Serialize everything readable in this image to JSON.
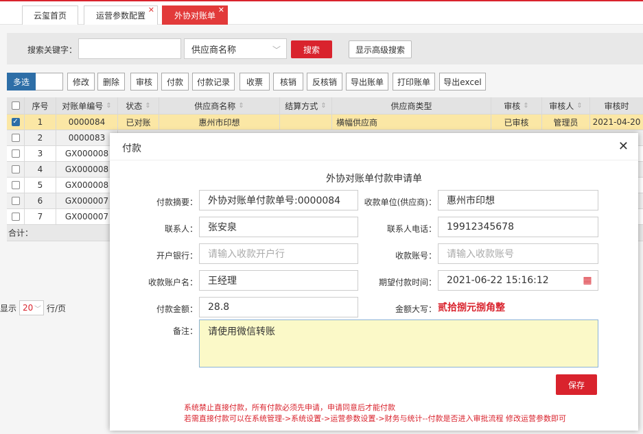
{
  "tabs": [
    {
      "label": "云玺首页",
      "closable": false
    },
    {
      "label": "运营参数配置",
      "closable": true
    },
    {
      "label": "外协对账单",
      "closable": true,
      "active": true
    }
  ],
  "search": {
    "keyword_label": "搜索关键字：",
    "keyword_value": "",
    "field_select": "供应商名称",
    "search_button": "搜索",
    "advanced_button": "显示高级搜索"
  },
  "toolbar": {
    "multi": "多选",
    "buttons": [
      "修改",
      "删除",
      "审核",
      "付款",
      "付款记录",
      "收票",
      "核销",
      "反核销",
      "导出账单",
      "打印账单",
      "导出excel"
    ]
  },
  "table": {
    "headers": [
      "序号",
      "对账单编号",
      "状态",
      "供应商名称",
      "结算方式",
      "供应商类型",
      "审核",
      "审核人",
      "审核时"
    ],
    "rows": [
      {
        "no": "1",
        "code": "0000084",
        "status": "已对账",
        "supplier": "惠州市印想",
        "settle": "",
        "type": "横幅供应商",
        "audit": "已审核",
        "auditor": "管理员",
        "time": "2021-04-20",
        "checked": true
      },
      {
        "no": "2",
        "code": "0000083",
        "checked": false
      },
      {
        "no": "3",
        "code": "GX000008",
        "checked": false
      },
      {
        "no": "4",
        "code": "GX000008",
        "checked": false
      },
      {
        "no": "5",
        "code": "GX000008",
        "checked": false
      },
      {
        "no": "6",
        "code": "GX000007",
        "checked": false
      },
      {
        "no": "7",
        "code": "GX000007",
        "checked": false
      }
    ],
    "total_label": "合计："
  },
  "pager": {
    "prefix": "显示",
    "size": "20",
    "suffix": "行/页"
  },
  "modal": {
    "title": "付款",
    "form_title": "外协对账单付款申请单",
    "fields": {
      "summary_label": "付款摘要：",
      "summary_value": "外协对账单付款单号:0000084",
      "payee_label": "收款单位(供应商)：",
      "payee_value": "惠州市印想",
      "contact_label": "联系人：",
      "contact_value": "张安泉",
      "phone_label": "联系人电话：",
      "phone_value": "19912345678",
      "bank_label": "开户银行：",
      "bank_placeholder": "请输入收款开户行",
      "account_label": "收款账号：",
      "account_placeholder": "请输入收款账号",
      "account_name_label": "收款账户名：",
      "account_name_value": "王经理",
      "expect_time_label": "期望付款时间：",
      "expect_time_value": "2021-06-22 15:16:12",
      "amount_label": "付款金额：",
      "amount_value": "28.8",
      "amount_upper_label": "金额大写：",
      "amount_upper_value": "贰拾捌元捌角整",
      "note_label": "备注：",
      "note_value": "请使用微信转账"
    },
    "save_button": "保存",
    "warning_1": "系统禁止直接付款，所有付款必须先申请，申请同意后才能付款",
    "warning_2": "若需直接付款可以在系统管理->系统设置->运营参数设置->财务与统计--付款是否进入审批流程 修改运营参数即可"
  },
  "colors": {
    "accent": "#d9232d",
    "primary": "#2d6ea7",
    "selected_row": "#fbe7a5"
  }
}
